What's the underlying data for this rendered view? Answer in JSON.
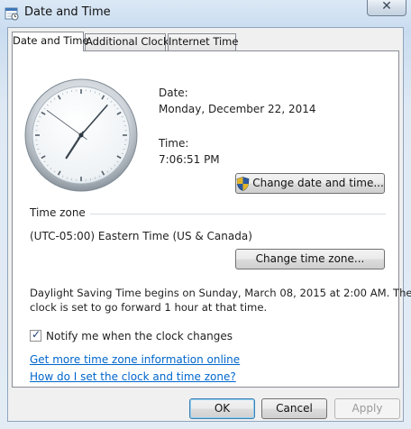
{
  "window": {
    "title": "Date and Time",
    "close_glyph": "✕"
  },
  "tabs": [
    {
      "label": "Date and Time",
      "active": true
    },
    {
      "label": "Additional Clocks",
      "active": false
    },
    {
      "label": "Internet Time",
      "active": false
    }
  ],
  "datetime": {
    "date_label": "Date:",
    "date_value": "Monday, December 22, 2014",
    "time_label": "Time:",
    "time_value": "7:06:51 PM",
    "change_button": "Change date and time..."
  },
  "timezone": {
    "section_label": "Time zone",
    "value": "(UTC-05:00) Eastern Time (US & Canada)",
    "change_button": "Change time zone..."
  },
  "dst": {
    "line1": "Daylight Saving Time begins on Sunday, March 08, 2015 at 2:00 AM. The",
    "line2": "clock is set to go forward 1 hour at that time."
  },
  "notify": {
    "label": "Notify me when the clock changes",
    "checked": true
  },
  "links": {
    "more_info": "Get more time zone information online",
    "how_to": "How do I set the clock and time zone?"
  },
  "footer": {
    "ok": "OK",
    "cancel": "Cancel",
    "apply": "Apply"
  },
  "clock": {
    "hour": 7,
    "minute": 6,
    "second": 51
  },
  "icons": {
    "window_icon": "calendar-clock-icon",
    "uac_shield": "uac-shield-icon",
    "check": "checkmark-icon"
  },
  "colors": {
    "link": "#0066cc",
    "frame_blue": "#c9dcef"
  }
}
